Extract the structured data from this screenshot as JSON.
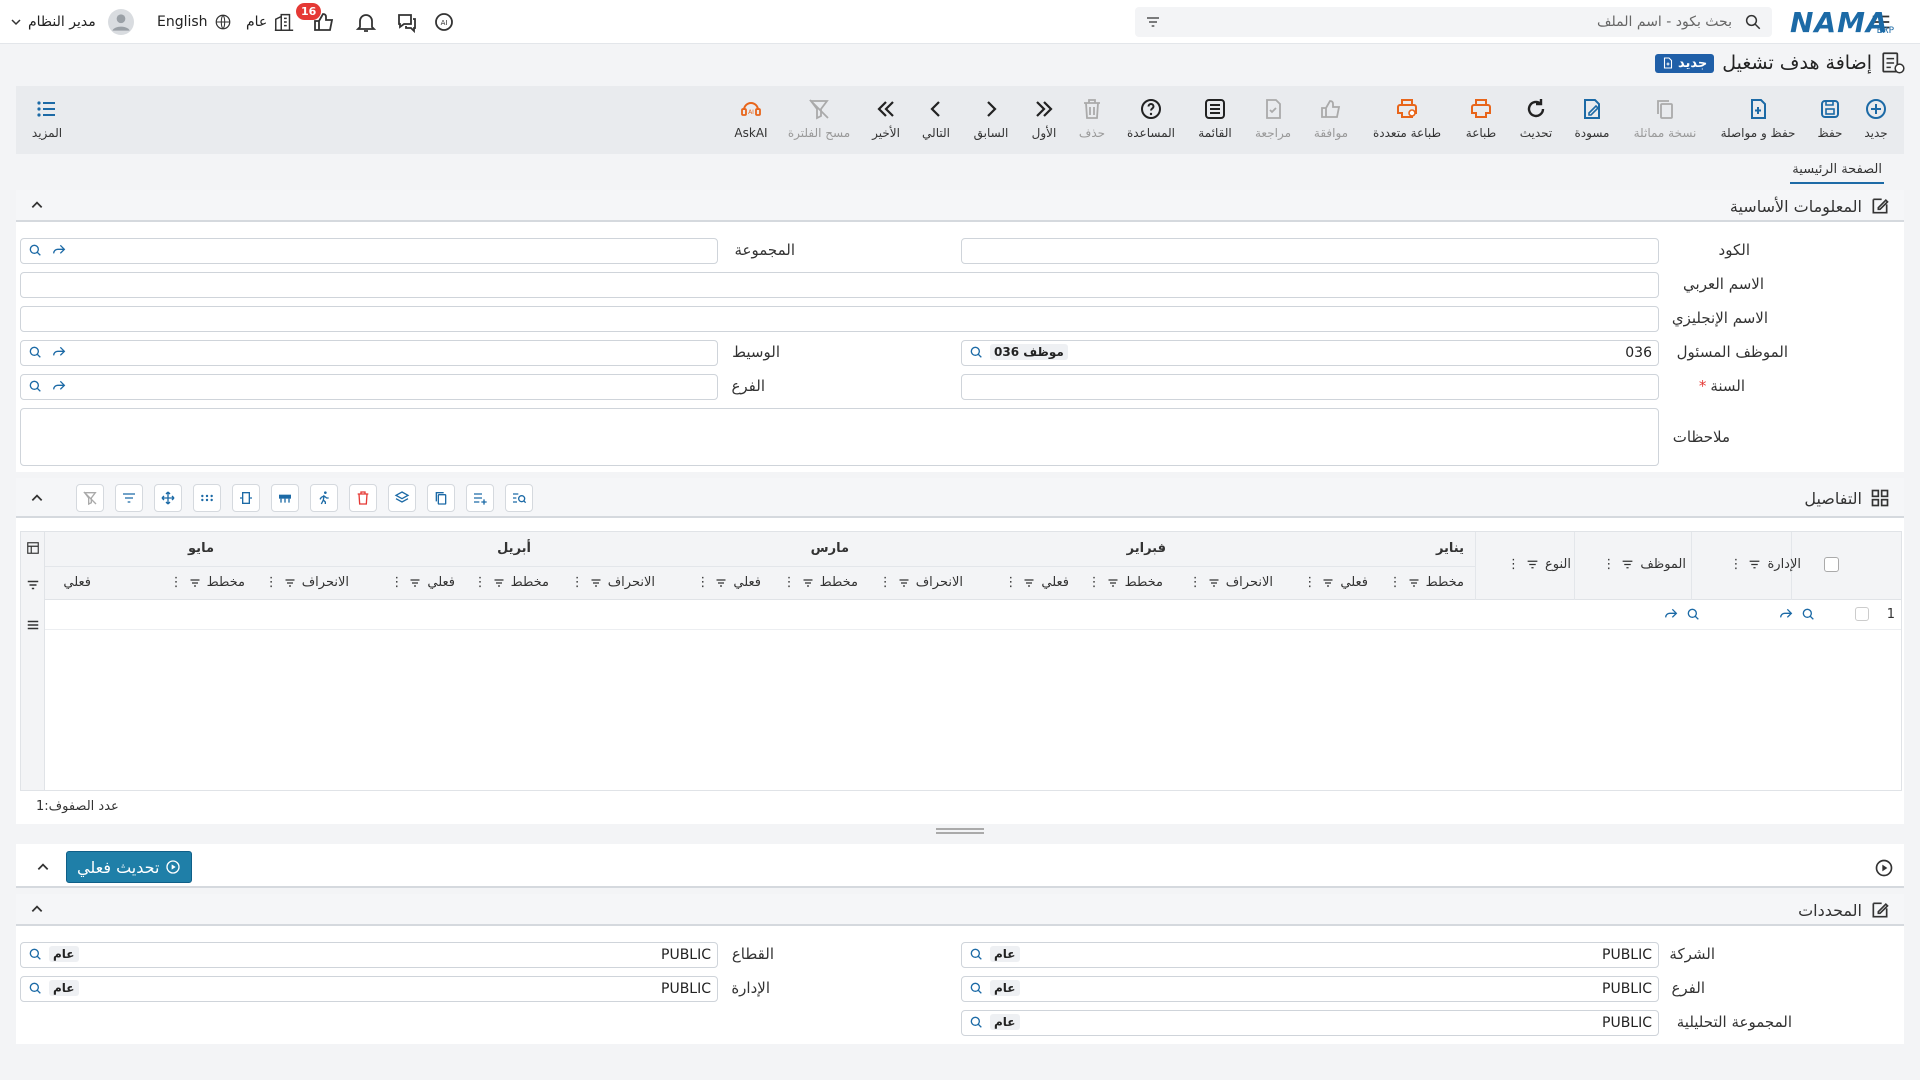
{
  "app": {
    "logo": "NAMA",
    "logo_sub": "ERP"
  },
  "topbar": {
    "search_placeholder": "بحث بكود - اسم الملف",
    "user_name": "مدير النظام",
    "language": "English",
    "context": "عام",
    "notifications_badge": "16"
  },
  "page": {
    "title": "إضافة هدف تشغيل",
    "new_badge": "جديد"
  },
  "toolbar": {
    "new": "جديد",
    "save": "حفظ",
    "save_continue": "حفظ و مواصلة",
    "duplicate": "نسخة مماثلة",
    "draft": "مسودة",
    "refresh": "تحديث",
    "print": "طباعة",
    "multi_print": "طباعة متعددة",
    "approve": "موافقة",
    "review": "مراجعة",
    "list": "القائمة",
    "help": "المساعدة",
    "delete": "حذف",
    "first": "الأول",
    "previous": "السابق",
    "next": "التالي",
    "last": "الأخير",
    "clear_filter": "مسح الفلترة",
    "askai": "AskAI",
    "more": "المزيد"
  },
  "tabs": {
    "main": "الصفحة الرئيسية"
  },
  "basic_info": {
    "title": "المعلومات الأساسية",
    "code_label": "الكود",
    "code_value": "",
    "group_label": "المجموعة",
    "group_value": "",
    "arabic_name_label": "الاسم العربي",
    "arabic_name_value": "",
    "english_name_label": "الاسم الإنجليزي",
    "english_name_value": "",
    "employee_label": "الموظف المسئول",
    "employee_value": "036",
    "employee_tag": "موظف 036",
    "broker_label": "الوسيط",
    "broker_value": "",
    "year_label": "السنة",
    "year_required": "*",
    "year_value": "",
    "branch_label": "الفرع",
    "branch_value": "",
    "notes_label": "ملاحظات",
    "notes_value": ""
  },
  "details": {
    "title": "التفاصيل",
    "columns": {
      "management": "الإدارة",
      "employee": "الموظف",
      "type": "النوع",
      "months": [
        "يناير",
        "فبراير",
        "مارس",
        "أبريل",
        "مايو"
      ],
      "planned": "مخطط",
      "actual": "فعلي",
      "deviation": "الانحراف"
    },
    "rows": [
      {
        "index": "1"
      }
    ],
    "row_count_label": "عدد الصفوف:",
    "row_count": "1"
  },
  "actions": {
    "refresh_actual": "تحديث فعلي"
  },
  "determinants": {
    "title": "المحددات",
    "company_label": "الشركة",
    "company_value": "PUBLIC",
    "company_tag": "عام",
    "sector_label": "القطاع",
    "sector_value": "PUBLIC",
    "sector_tag": "عام",
    "branch_label": "الفرع",
    "branch_value": "PUBLIC",
    "branch_tag": "عام",
    "department_label": "الإدارة",
    "department_value": "PUBLIC",
    "department_tag": "عام",
    "analytic_group_label": "المجموعة التحليلية",
    "analytic_group_value": "PUBLIC",
    "analytic_group_tag": "عام"
  },
  "colors": {
    "accent": "#1c6aa6",
    "orange": "#e8651a",
    "badge": "#e53935",
    "button": "#1f7fa8"
  }
}
